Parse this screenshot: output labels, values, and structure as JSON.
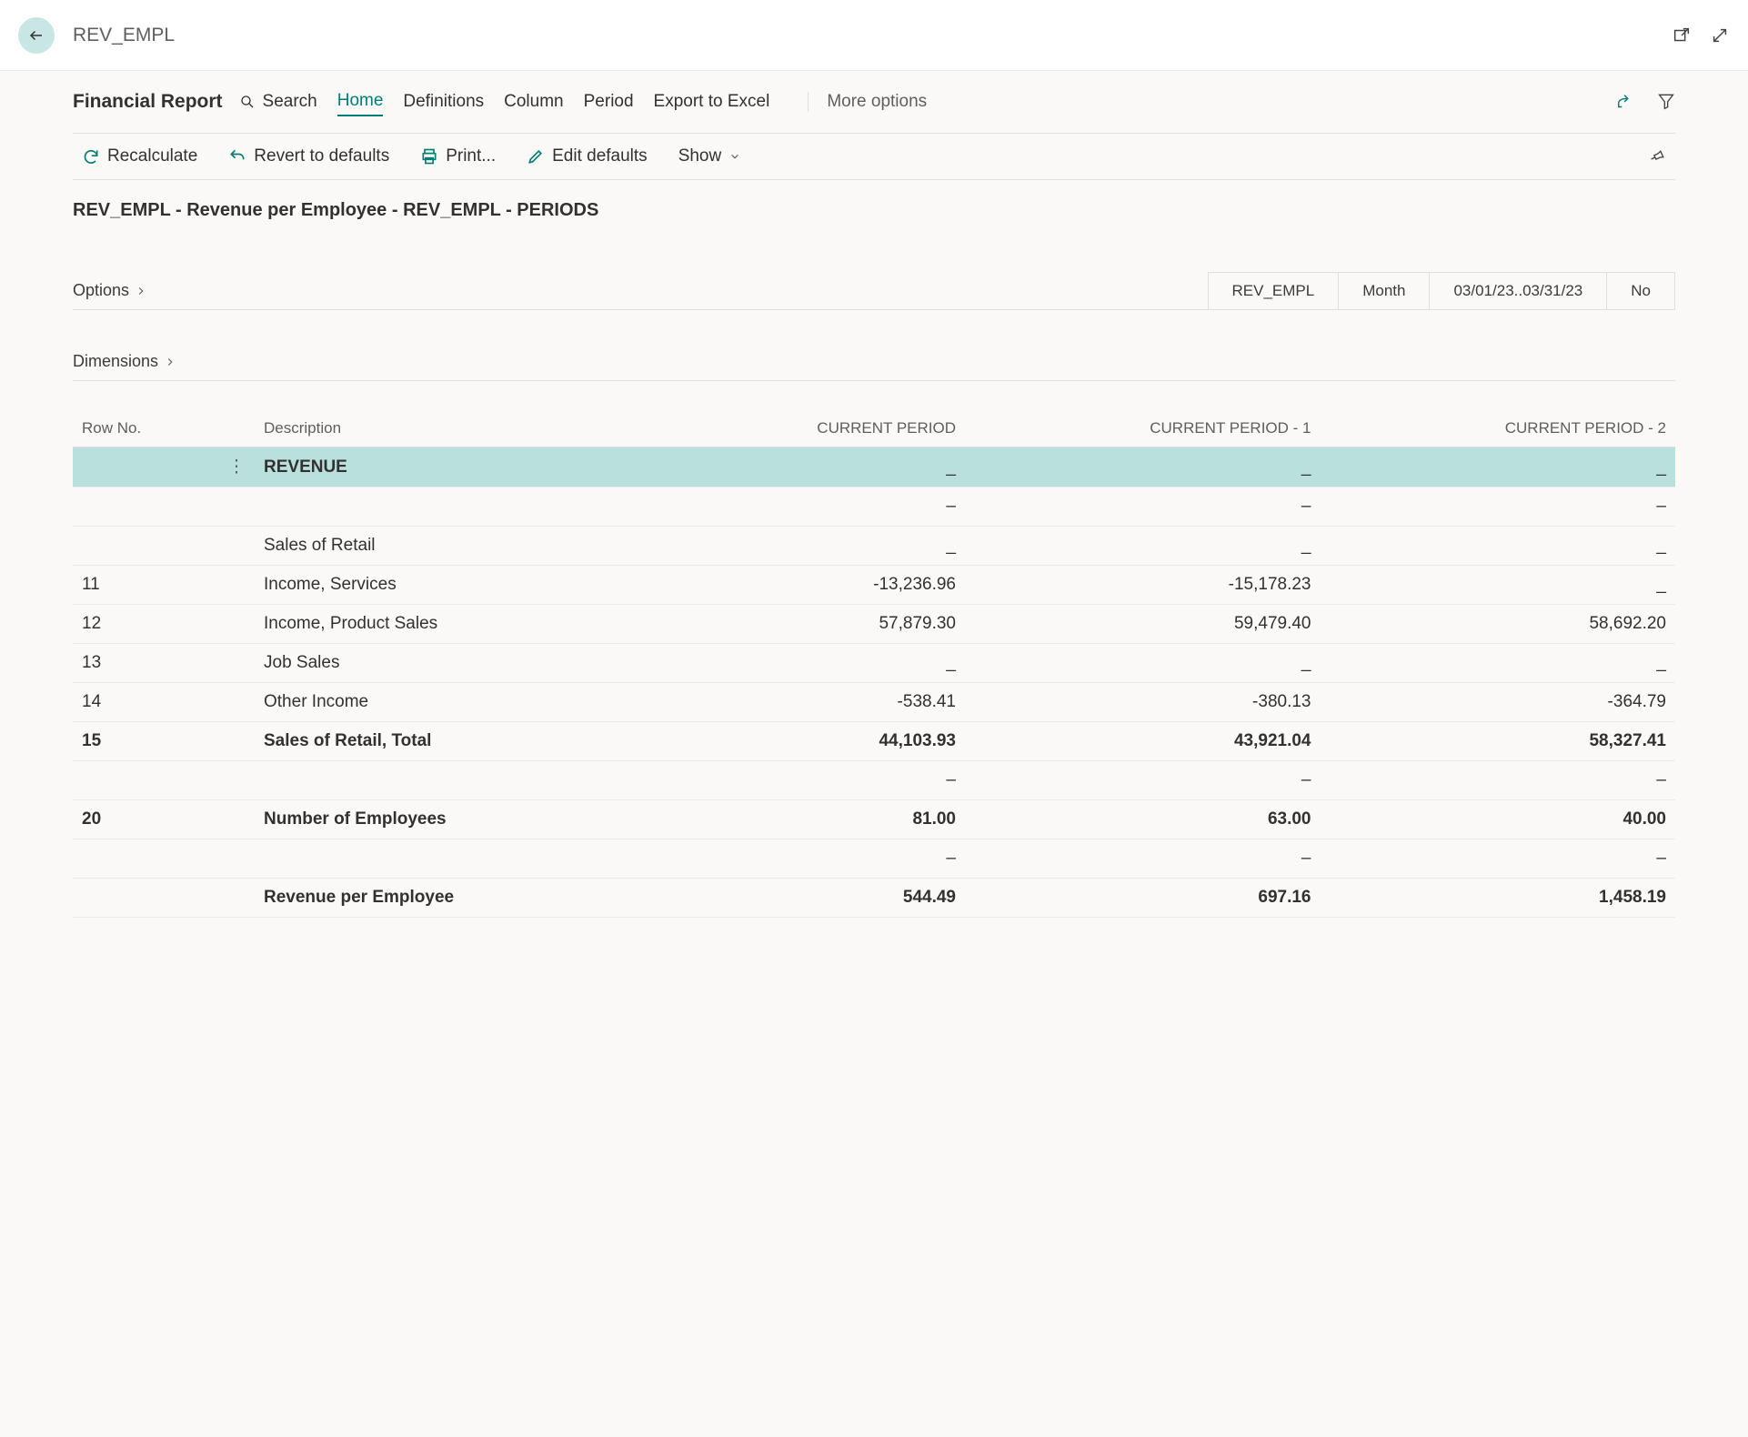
{
  "header": {
    "title": "REV_EMPL"
  },
  "subhead": {
    "title": "Financial Report",
    "search_label": "Search",
    "tabs": {
      "home": "Home",
      "definitions": "Definitions",
      "column": "Column",
      "period": "Period",
      "export": "Export to Excel"
    },
    "more_options": "More options"
  },
  "actions": {
    "recalculate": "Recalculate",
    "revert": "Revert to defaults",
    "print": "Print...",
    "edit_defaults": "Edit defaults",
    "show": "Show"
  },
  "report_label": "REV_EMPL - Revenue per Employee - REV_EMPL - PERIODS",
  "sections": {
    "options_label": "Options",
    "dimensions_label": "Dimensions"
  },
  "options": {
    "code": "REV_EMPL",
    "period_type": "Month",
    "date_range": "03/01/23..03/31/23",
    "aux": "No"
  },
  "grid": {
    "headers": {
      "rowno": "Row No.",
      "description": "Description",
      "cp": "CURRENT PERIOD",
      "cp1": "CURRENT PERIOD - 1",
      "cp2": "CURRENT PERIOD - 2"
    },
    "rows": [
      {
        "rowno": "",
        "description": "REVENUE",
        "cp": "_",
        "cp1": "_",
        "cp2": "_",
        "highlight": true
      },
      {
        "rowno": "",
        "description": "",
        "cp": "–",
        "cp1": "–",
        "cp2": "–"
      },
      {
        "rowno": "",
        "description": "Sales of Retail",
        "cp": "_",
        "cp1": "_",
        "cp2": "_"
      },
      {
        "rowno": "11",
        "description": "Income, Services",
        "cp": "-13,236.96",
        "cp1": "-15,178.23",
        "cp2": "_"
      },
      {
        "rowno": "12",
        "description": "Income, Product Sales",
        "cp": "57,879.30",
        "cp1": "59,479.40",
        "cp2": "58,692.20"
      },
      {
        "rowno": "13",
        "description": "Job Sales",
        "cp": "_",
        "cp1": "_",
        "cp2": "_"
      },
      {
        "rowno": "14",
        "description": "Other Income",
        "cp": "-538.41",
        "cp1": "-380.13",
        "cp2": "-364.79"
      },
      {
        "rowno": "15",
        "description": "Sales of Retail, Total",
        "cp": "44,103.93",
        "cp1": "43,921.04",
        "cp2": "58,327.41",
        "bold": true
      },
      {
        "rowno": "",
        "description": "",
        "cp": "–",
        "cp1": "–",
        "cp2": "–"
      },
      {
        "rowno": "20",
        "description": "Number of Employees",
        "cp": "81.00",
        "cp1": "63.00",
        "cp2": "40.00",
        "bold": true
      },
      {
        "rowno": "",
        "description": "",
        "cp": "–",
        "cp1": "–",
        "cp2": "–"
      },
      {
        "rowno": "",
        "description": "Revenue per Employee",
        "cp": "544.49",
        "cp1": "697.16",
        "cp2": "1,458.19",
        "bold": true
      }
    ]
  }
}
